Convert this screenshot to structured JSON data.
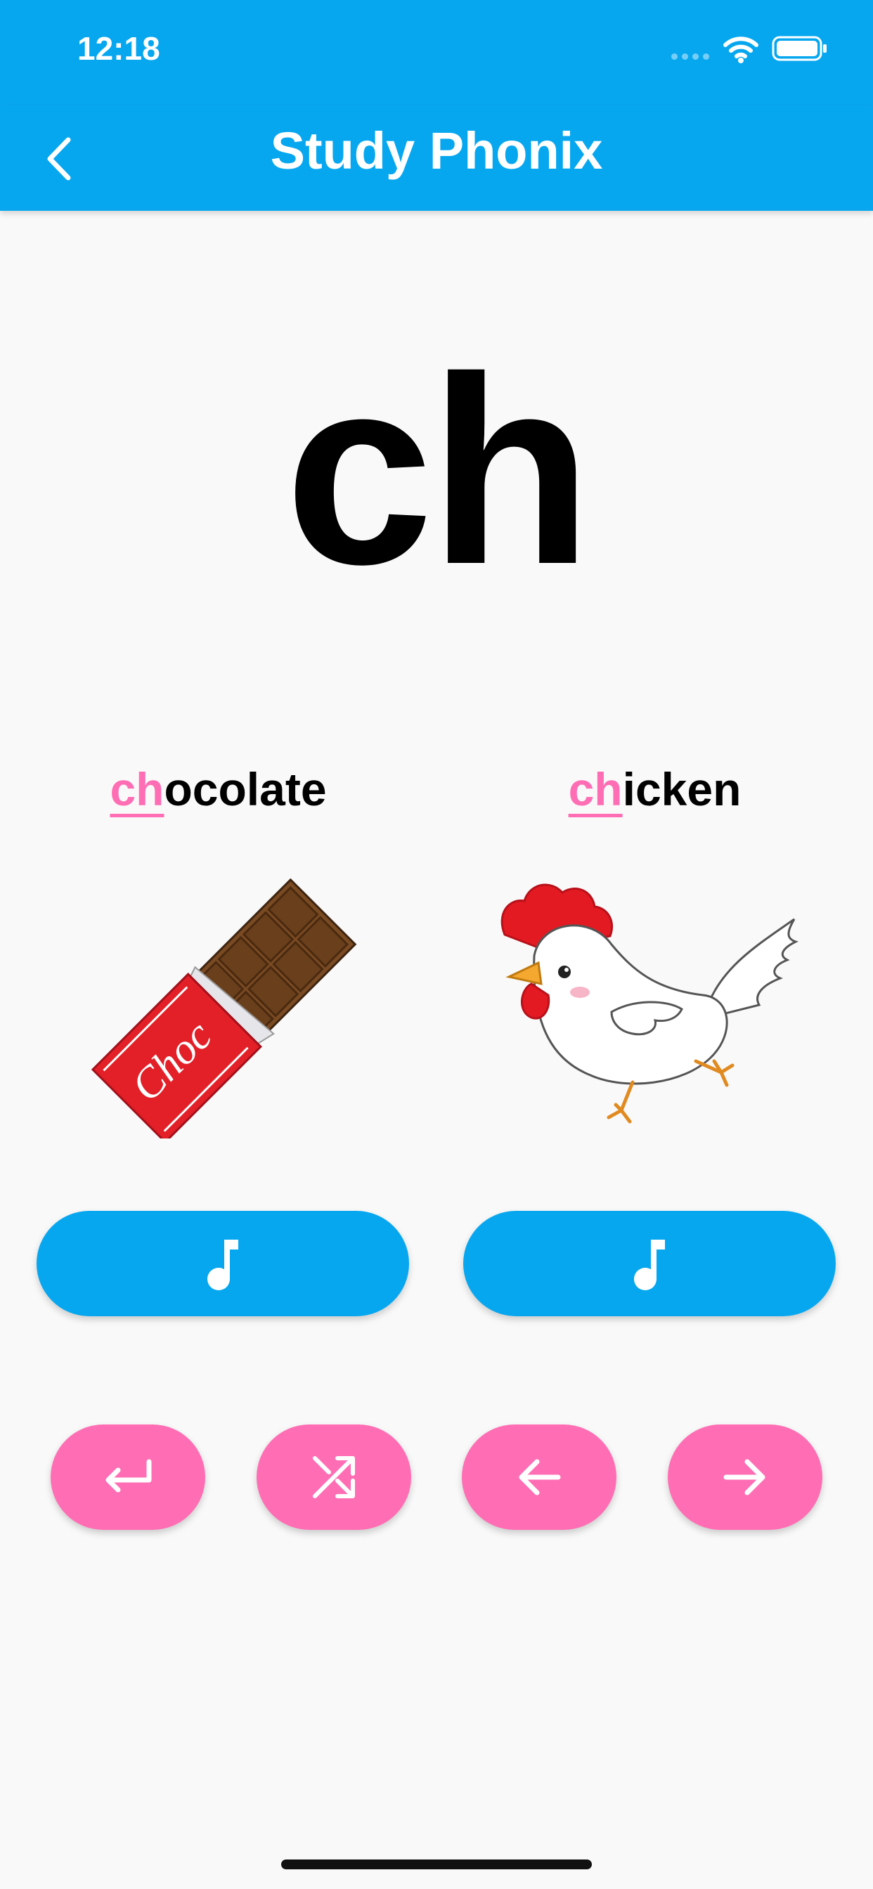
{
  "status_bar": {
    "time": "12:18"
  },
  "nav": {
    "title": "Study Phonix",
    "back_icon": "chevron-left-icon"
  },
  "phonics": {
    "letters": "ch"
  },
  "words": [
    {
      "highlight": "ch",
      "rest": "ocolate",
      "image": "chocolate-bar-illustration",
      "wrapper_text": "Choc"
    },
    {
      "highlight": "ch",
      "rest": "icken",
      "image": "chicken-illustration"
    }
  ],
  "sound_buttons": [
    {
      "icon": "music-note-icon"
    },
    {
      "icon": "music-note-icon"
    }
  ],
  "controls": [
    {
      "icon": "return-icon"
    },
    {
      "icon": "shuffle-icon"
    },
    {
      "icon": "arrow-left-icon"
    },
    {
      "icon": "arrow-right-icon"
    }
  ],
  "colors": {
    "primary_blue": "#07a7f0",
    "accent_pink": "#ff6eb4",
    "background": "#f9f9f9"
  }
}
